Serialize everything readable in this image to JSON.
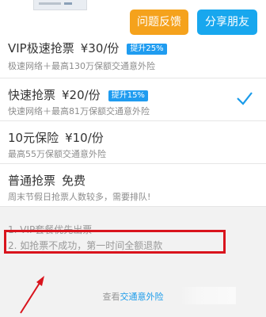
{
  "header": {
    "feedback_label": "问题反馈",
    "share_label": "分享朋友"
  },
  "options": [
    {
      "title": "VIP极速抢票",
      "price": "¥30/份",
      "badge": "提升25%",
      "desc": "极速网络＋最高130万保额交通意外险",
      "selected": false
    },
    {
      "title": "快速抢票",
      "price": "¥20/份",
      "badge": "提升15%",
      "desc": "快速网络＋最高81万保额交通意外险",
      "selected": true
    },
    {
      "title": "10元保险",
      "price": "¥10/份",
      "badge": "",
      "desc": "最高55万保额交通意外险",
      "selected": false
    },
    {
      "title": "普通抢票",
      "price": "免费",
      "badge": "",
      "desc": "周末节假日抢票人数较多，需要排队!",
      "selected": false
    }
  ],
  "notes": [
    "1. VIP套餐优先出票",
    "2. 如抢票不成功，第一时间全额退款"
  ],
  "footer": {
    "prefix": "查看",
    "link": "交通意外险"
  },
  "colors": {
    "orange": "#f5a21c",
    "blue": "#18a7ee",
    "highlight": "#d9141d"
  }
}
